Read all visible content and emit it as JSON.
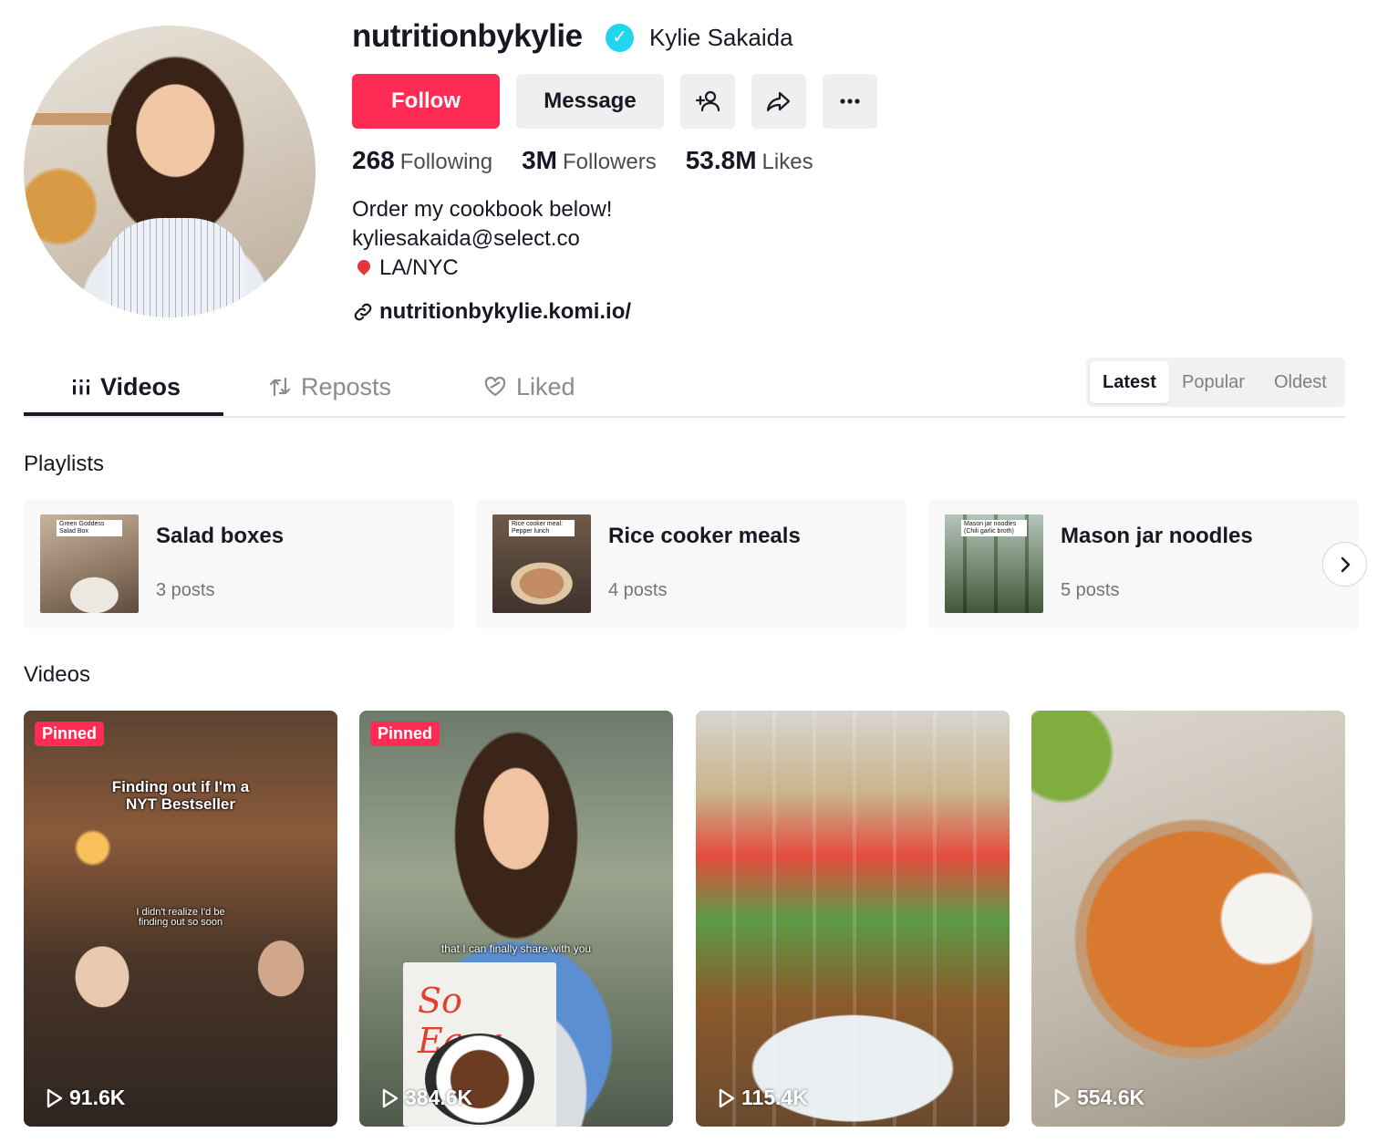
{
  "profile": {
    "username": "nutritionbykylie",
    "nickname": "Kylie Sakaida",
    "verified": true,
    "follow_label": "Follow",
    "message_label": "Message",
    "stats": {
      "following_count": "268",
      "following_label": "Following",
      "followers_count": "3M",
      "followers_label": "Followers",
      "likes_count": "53.8M",
      "likes_label": "Likes"
    },
    "bio": {
      "line1": "Order my cookbook below!",
      "line2": "kyliesakaida@select.co",
      "line3": "LA/NYC"
    },
    "link": "nutritionbykylie.komi.io/"
  },
  "tabs": {
    "videos": "Videos",
    "reposts": "Reposts",
    "liked": "Liked",
    "active": "videos"
  },
  "sort": {
    "latest": "Latest",
    "popular": "Popular",
    "oldest": "Oldest",
    "active": "latest"
  },
  "playlists": {
    "title": "Playlists",
    "items": [
      {
        "name": "Salad boxes",
        "count": "3 posts",
        "thumb_caption": "Green Goddess Salad Box"
      },
      {
        "name": "Rice cooker meals",
        "count": "4 posts",
        "thumb_caption": "Rice cooker meal: Pepper lunch"
      },
      {
        "name": "Mason jar noodles",
        "count": "5 posts",
        "thumb_caption": "Mason jar noodles (Chili garlic broth)"
      }
    ]
  },
  "videos": {
    "title": "Videos",
    "pinned_label": "Pinned",
    "items": [
      {
        "views": "91.6K",
        "pinned": true,
        "overlay_main": "Finding out if I'm a NYT Bestseller",
        "overlay_sub": "I didn't realize I'd be finding out so soon"
      },
      {
        "views": "384.6K",
        "pinned": true,
        "overlay_main": "that I can finally share with you",
        "book_title": "So Easy"
      },
      {
        "views": "115.4K",
        "pinned": false
      },
      {
        "views": "554.6K",
        "pinned": false
      }
    ]
  },
  "colors": {
    "brand": "#fe2c55",
    "verified": "#20d5ec",
    "text": "#161823",
    "muted": "#73747b"
  }
}
